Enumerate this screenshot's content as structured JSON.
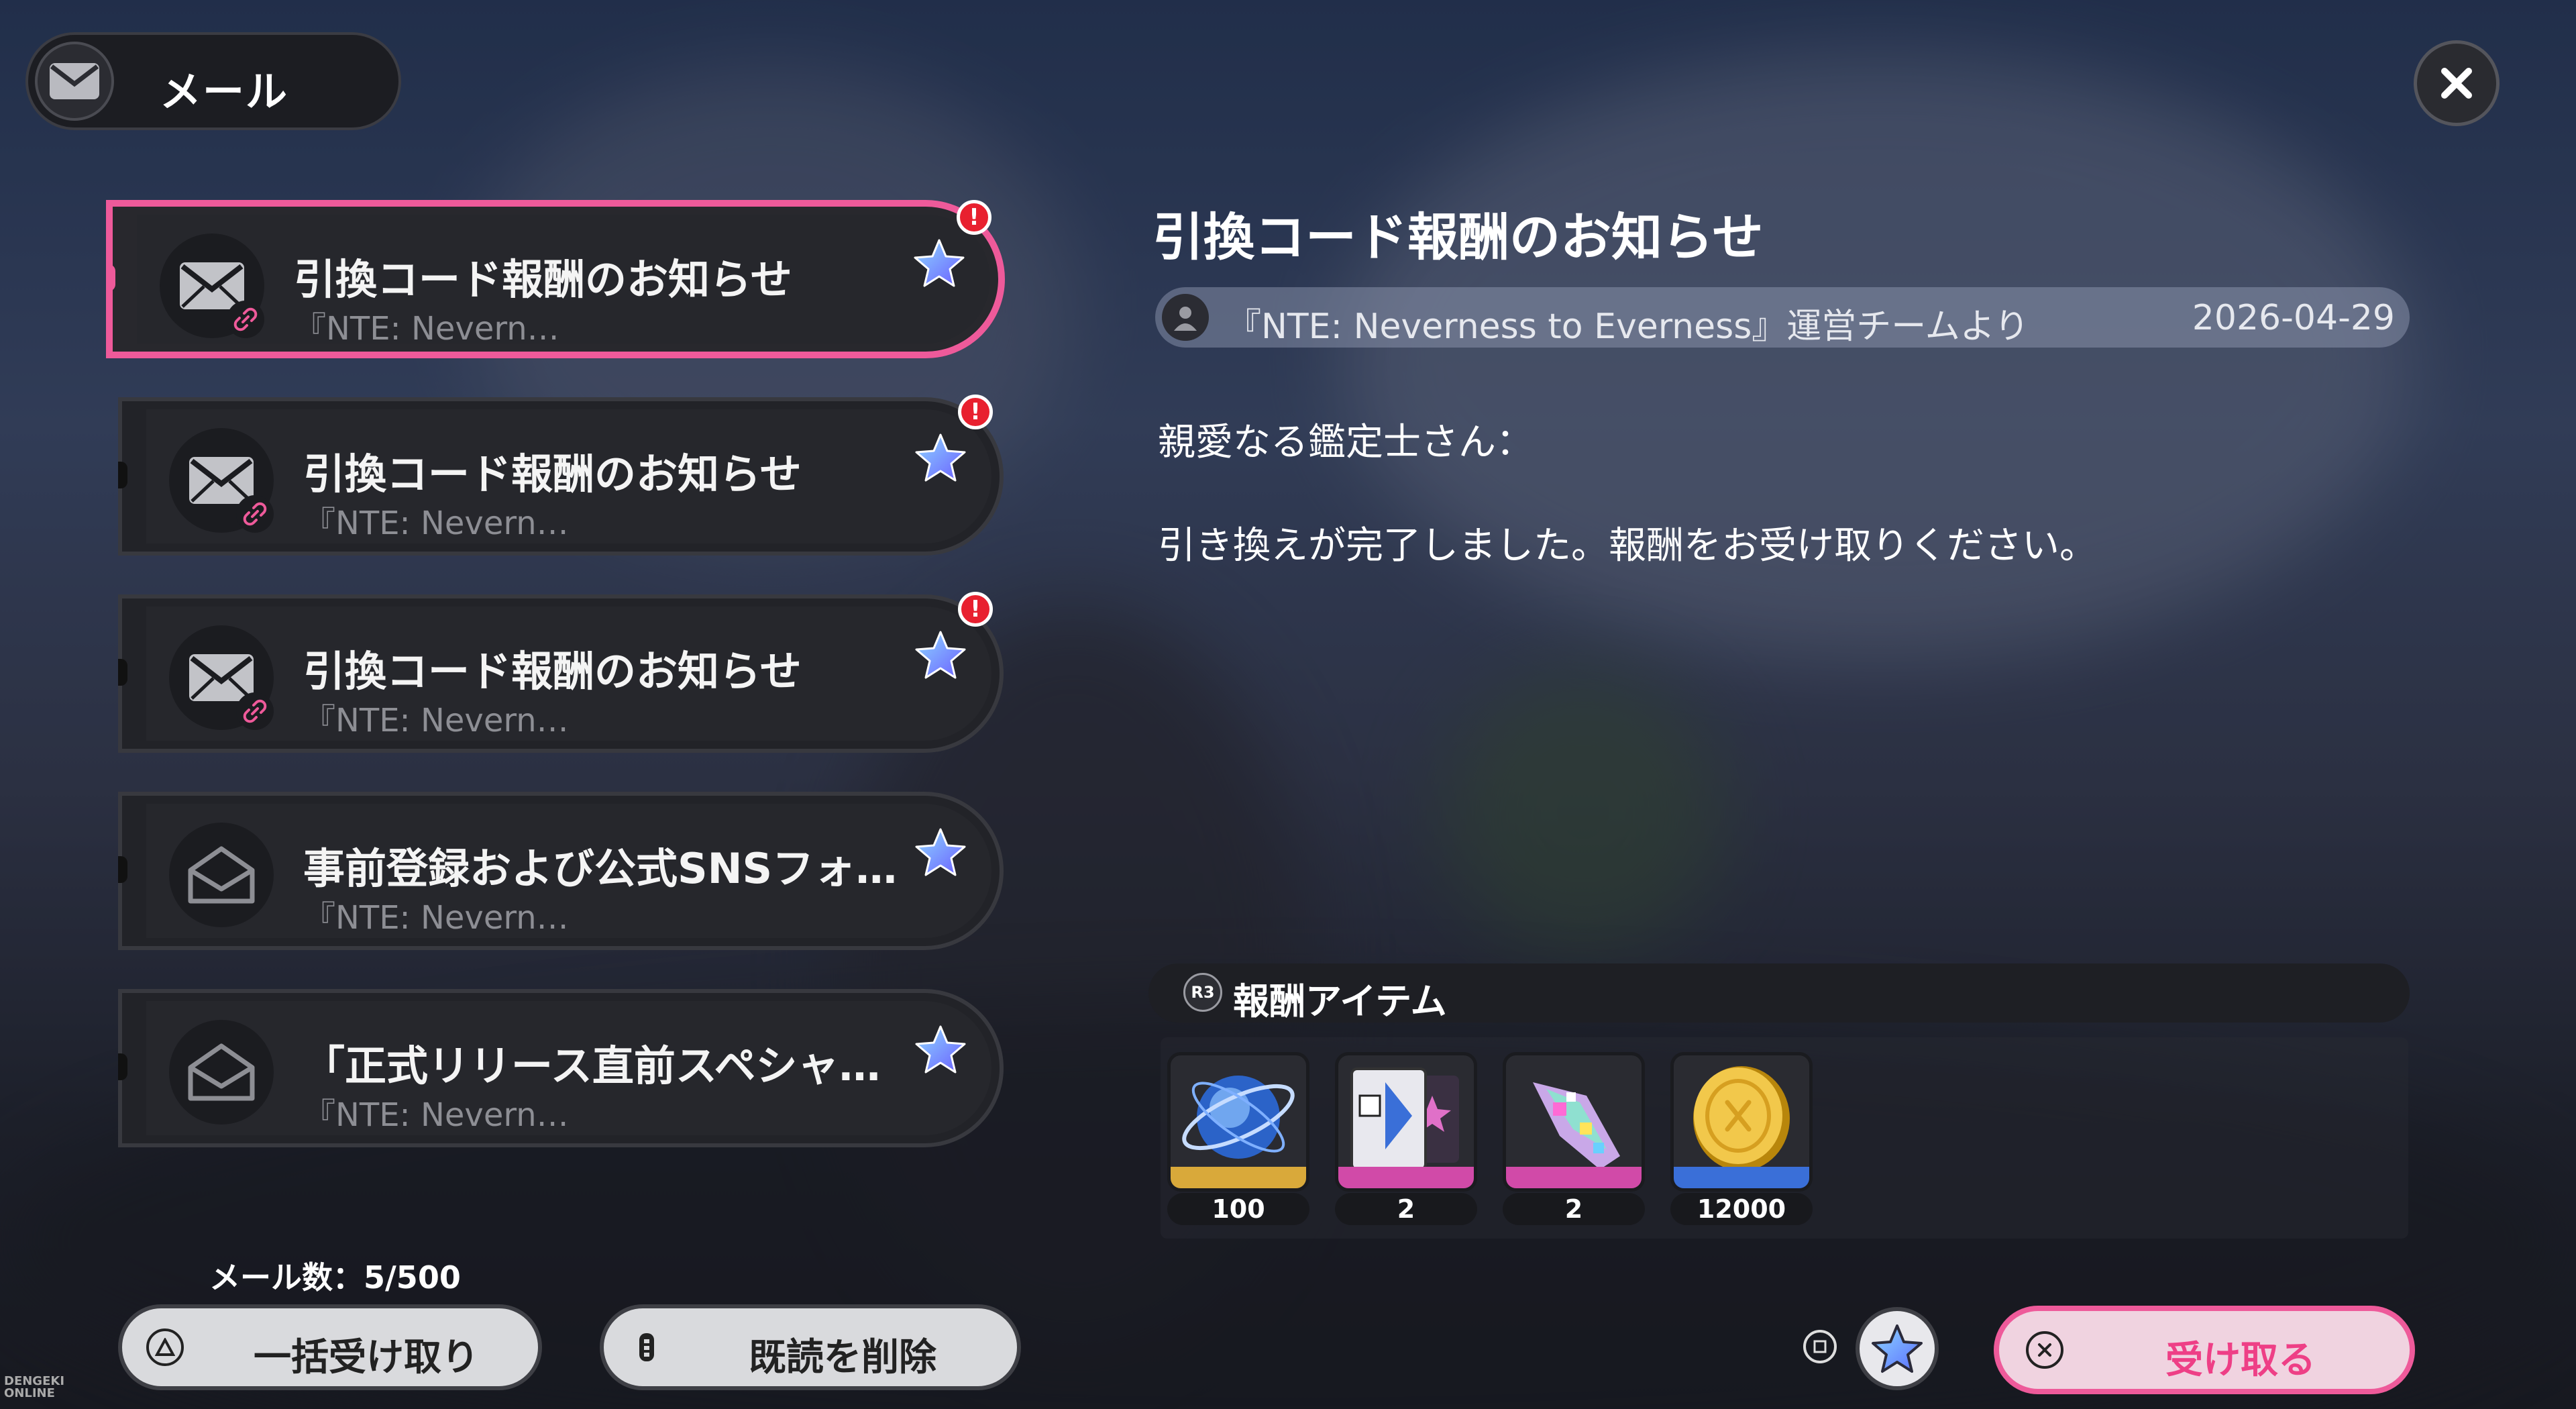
{
  "header": {
    "title": "メール"
  },
  "mails": [
    {
      "title": "引換コード報酬のお知らせ",
      "subtitle": "『NTE: Nevern…",
      "alert": "!",
      "read": false,
      "active": true,
      "has_link": true
    },
    {
      "title": "引換コード報酬のお知らせ",
      "subtitle": "『NTE: Nevern…",
      "alert": "!",
      "read": false,
      "active": false,
      "has_link": true
    },
    {
      "title": "引換コード報酬のお知らせ",
      "subtitle": "『NTE: Nevern…",
      "alert": "!",
      "read": false,
      "active": false,
      "has_link": true
    },
    {
      "title": "事前登録および公式SNSフォ…",
      "subtitle": "『NTE: Nevern…",
      "alert": "",
      "read": true,
      "active": false,
      "has_link": false
    },
    {
      "title": "「正式リリース直前スペシャ…",
      "subtitle": "『NTE: Nevern…",
      "alert": "",
      "read": true,
      "active": false,
      "has_link": false
    }
  ],
  "detail": {
    "title": "引換コード報酬のお知らせ",
    "sender": "『NTE: Neverness to Everness』運営チームより",
    "date": "2026-04-29",
    "greeting": "親愛なる鑑定士さん：",
    "body": "引き換えが完了しました。報酬をお受け取りください。"
  },
  "rewards": {
    "button_glyph": "R3",
    "label": "報酬アイテム",
    "items": [
      {
        "icon": "blue-orb-icon",
        "qty": "100",
        "rarity_color": "#d9a93a"
      },
      {
        "icon": "card-pack-icon",
        "qty": "2",
        "rarity_color": "#d14aa8"
      },
      {
        "icon": "crystal-shard-icon",
        "qty": "2",
        "rarity_color": "#d14aa8"
      },
      {
        "icon": "gold-coin-icon",
        "qty": "12000",
        "rarity_color": "#3a6fd8"
      }
    ]
  },
  "footer": {
    "mail_count": "メール数：5/500",
    "claim_all": "一括受け取り",
    "delete_read": "既読を削除",
    "claim": "受け取る"
  },
  "watermark": "DENGEKI ONLINE",
  "colors": {
    "accent": "#ee5a9a",
    "alert": "#e8202f"
  }
}
